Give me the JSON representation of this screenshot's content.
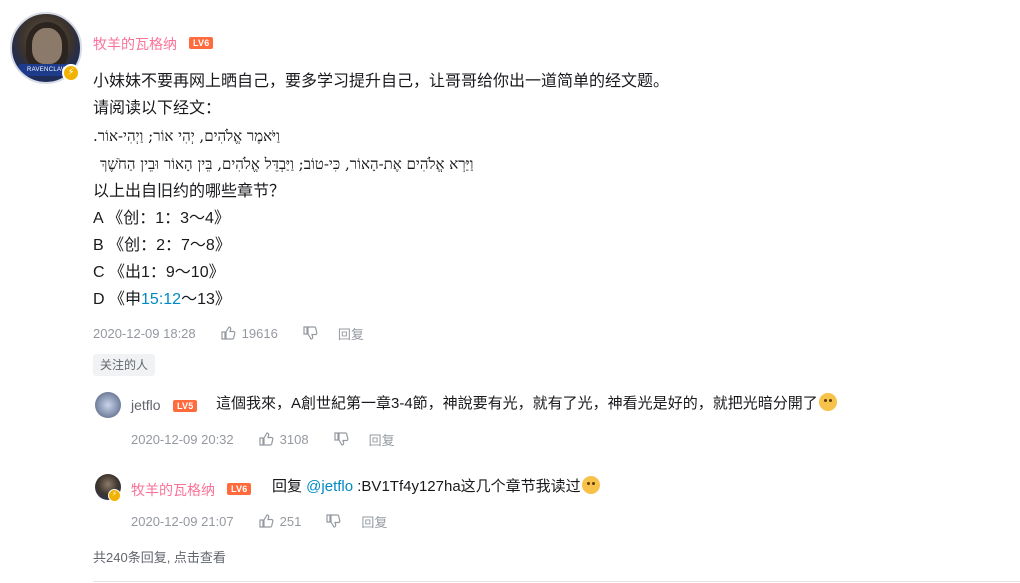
{
  "main_comment": {
    "username": "牧羊的瓦格纳",
    "level": "LV6",
    "avatar_banner": "RAVENCLAW",
    "lines": [
      "小妹妹不要再网上晒自己，要多学习提升自己，让哥哥给你出一道简单的经文题。",
      "请阅读以下经文：",
      "וַיֹּאמֶר אֱלֹהִים, יְהִי אוֹר; וַיְהִי-אוֹר.",
      "וַיַּרְא אֱלֹהִים אֶת-הָאוֹר, כִּי-טוֹב; וַיַּבְדֵּל אֱלֹהִים, בֵּין הָאוֹר וּבֵין הַחֹשֶׁךְ",
      "以上出自旧约的哪些章节？",
      "A 《创：1：3～4》",
      "B 《创：2：7～8》",
      "C 《出1：9～10》"
    ],
    "line_d_prefix": "D 《申",
    "line_d_link": "15:12",
    "line_d_suffix": "～13》",
    "timestamp": "2020-12-09 18:28",
    "likes": "19616",
    "reply_label": "回复"
  },
  "follow_tag": "关注的人",
  "replies": [
    {
      "username": "jetflo",
      "level": "LV5",
      "text": "這個我來，A創世紀第一章3-4節，神說要有光，就有了光，神看光是好的，就把光暗分開了",
      "timestamp": "2020-12-09 20:32",
      "likes": "3108",
      "reply_label": "回复"
    },
    {
      "username": "牧羊的瓦格纳",
      "level": "LV6",
      "text_prefix": "回复 ",
      "mention": "@jetflo",
      "text": " :BV1Tf4y127ha这几个章节我读过",
      "timestamp": "2020-12-09 21:07",
      "likes": "251",
      "reply_label": "回复"
    }
  ],
  "total_replies": "共240条回复, 点击查看",
  "colors": {
    "username": "#fb7299",
    "meta": "#9499a0",
    "link": "#008ac5",
    "level_badge": "#ff6b3d"
  },
  "icons": [
    "like-icon",
    "dislike-icon",
    "lightning-badge-icon",
    "cat-emoji-icon"
  ]
}
